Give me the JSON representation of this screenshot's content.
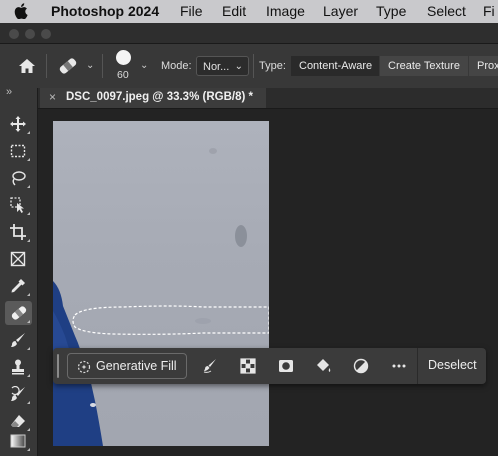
{
  "menubar": {
    "apple_icon": "apple-logo",
    "app_name": "Photoshop 2024",
    "items": [
      "File",
      "Edit",
      "Image",
      "Layer",
      "Type",
      "Select",
      "Fi"
    ]
  },
  "options_bar": {
    "home_icon": "home-icon",
    "tool_icon": "spot-healing-brush-icon",
    "brush_size": "60",
    "mode_label": "Mode:",
    "mode_value": "Nor...",
    "type_label": "Type:",
    "type_options": [
      "Content-Aware",
      "Create Texture",
      "Prox"
    ],
    "type_selected": "Content-Aware"
  },
  "document_tab": {
    "close_glyph": "×",
    "title": "DSC_0097.jpeg @ 33.3% (RGB/8) *"
  },
  "toolbar": {
    "collapse_glyph": "»",
    "tools": [
      "move-tool",
      "rectangular-marquee-tool",
      "lasso-tool",
      "object-selection-tool",
      "crop-tool",
      "frame-tool",
      "eyedropper-tool",
      "spot-healing-brush-tool",
      "brush-tool",
      "clone-stamp-tool",
      "history-brush-tool",
      "eraser-tool",
      "gradient-tool"
    ],
    "active_tool": "spot-healing-brush-tool"
  },
  "contextual_taskbar": {
    "generative_fill_label": "Generative Fill",
    "icons": [
      "modify-selection-icon",
      "select-inverse-icon",
      "create-mask-icon",
      "fill-selection-icon",
      "create-adjustment-layer-icon",
      "more-options-icon"
    ],
    "deselect_label": "Deselect"
  },
  "colors": {
    "ui_dark": "#232323",
    "panel": "#383838",
    "menubar": "#c9c9cc",
    "canvas_gray": "#a7abb5",
    "subject_blue": "#1f3f84"
  }
}
